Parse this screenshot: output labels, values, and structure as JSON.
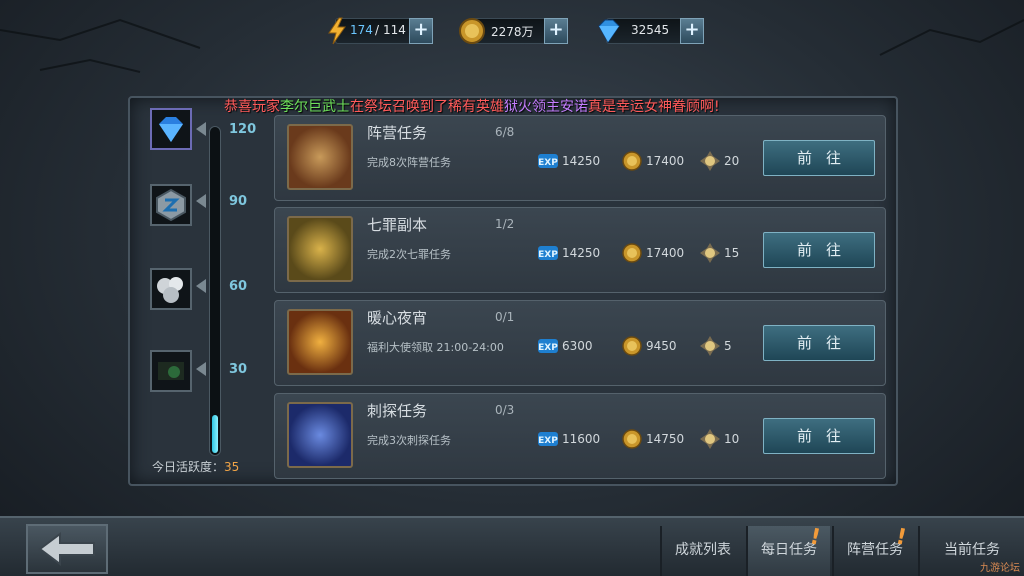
{
  "colors": {
    "accent": "#2ec4e0",
    "announce_red": "#ff5a5a",
    "announce_green": "#6ee05a",
    "announce_purple": "#c57dff",
    "activity_num": "#f0a447"
  },
  "resources": [
    {
      "icon": "lightning-icon",
      "value": "174",
      "max": "114"
    },
    {
      "icon": "gold-coin-icon",
      "value": "2278万"
    },
    {
      "icon": "diamond-icon",
      "value": "32545"
    }
  ],
  "announcement": {
    "p1": "恭喜玩家",
    "player": "李尔巨武士",
    "p2": "在祭坛召唤到了稀有英雄",
    "hero": "狱火领主安诺",
    "p3": "真是幸运女神眷顾啊!"
  },
  "activity": {
    "milestones": [
      "120",
      "90",
      "60",
      "30"
    ],
    "label": "今日活跃度：",
    "value": 35,
    "max": 120
  },
  "tasks": [
    {
      "name": "阵营任务",
      "progress": "6/8",
      "desc": "完成8次阵营任务",
      "exp": "14250",
      "gold": "17400",
      "points": "20",
      "button": "前往"
    },
    {
      "name": "七罪副本",
      "progress": "1/2",
      "desc": "完成2次七罪任务",
      "exp": "14250",
      "gold": "17400",
      "points": "15",
      "button": "前往"
    },
    {
      "name": "暖心夜宵",
      "progress": "0/1",
      "desc": "福利大使领取 21:00-24:00",
      "exp": "6300",
      "gold": "9450",
      "points": "5",
      "button": "前往"
    },
    {
      "name": "刺探任务",
      "progress": "0/3",
      "desc": "完成3次刺探任务",
      "exp": "11600",
      "gold": "14750",
      "points": "10",
      "button": "前往"
    }
  ],
  "nav": {
    "back_icon": "back-arrow-icon",
    "tabs": [
      "成就列表",
      "每日任务",
      "阵营任务",
      "当前任务"
    ],
    "active": "每日任务"
  },
  "watermark": "九游论坛"
}
